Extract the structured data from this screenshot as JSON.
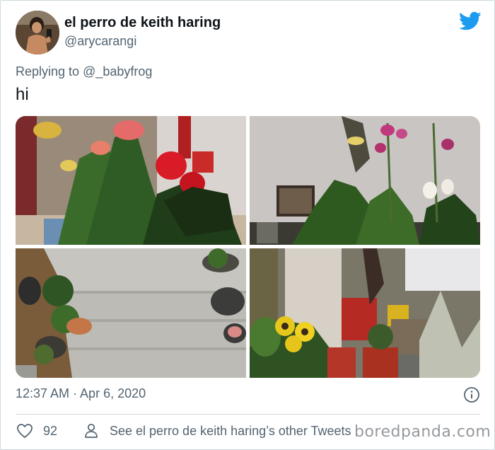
{
  "tweet": {
    "display_name": "el perro de keith haring",
    "handle": "@arycarangi",
    "replying_prefix": "Replying to",
    "replying_to": "@_babyfrog",
    "text": "hi",
    "timestamp": "12:37 AM · Apr 6, 2020",
    "like_count": "92",
    "see_more_label": "See el perro de keith haring’s other Tweets"
  },
  "media": {
    "photos": [
      {
        "subject": "red anthurium and lilies bouquet"
      },
      {
        "subject": "orchids and potted plants by a wall"
      },
      {
        "subject": "potted plants on concrete steps"
      },
      {
        "subject": "yellow pansies and potted plants near a column"
      }
    ]
  },
  "icons": {
    "brand": "twitter-bird-icon",
    "info": "info-icon",
    "like": "heart-icon",
    "profile": "person-icon"
  },
  "colors": {
    "twitter_blue": "#1d9bf0",
    "secondary_text": "#536471",
    "primary_text": "#0f1419",
    "border": "#cfd9de"
  },
  "watermark": "boredpanda.com"
}
